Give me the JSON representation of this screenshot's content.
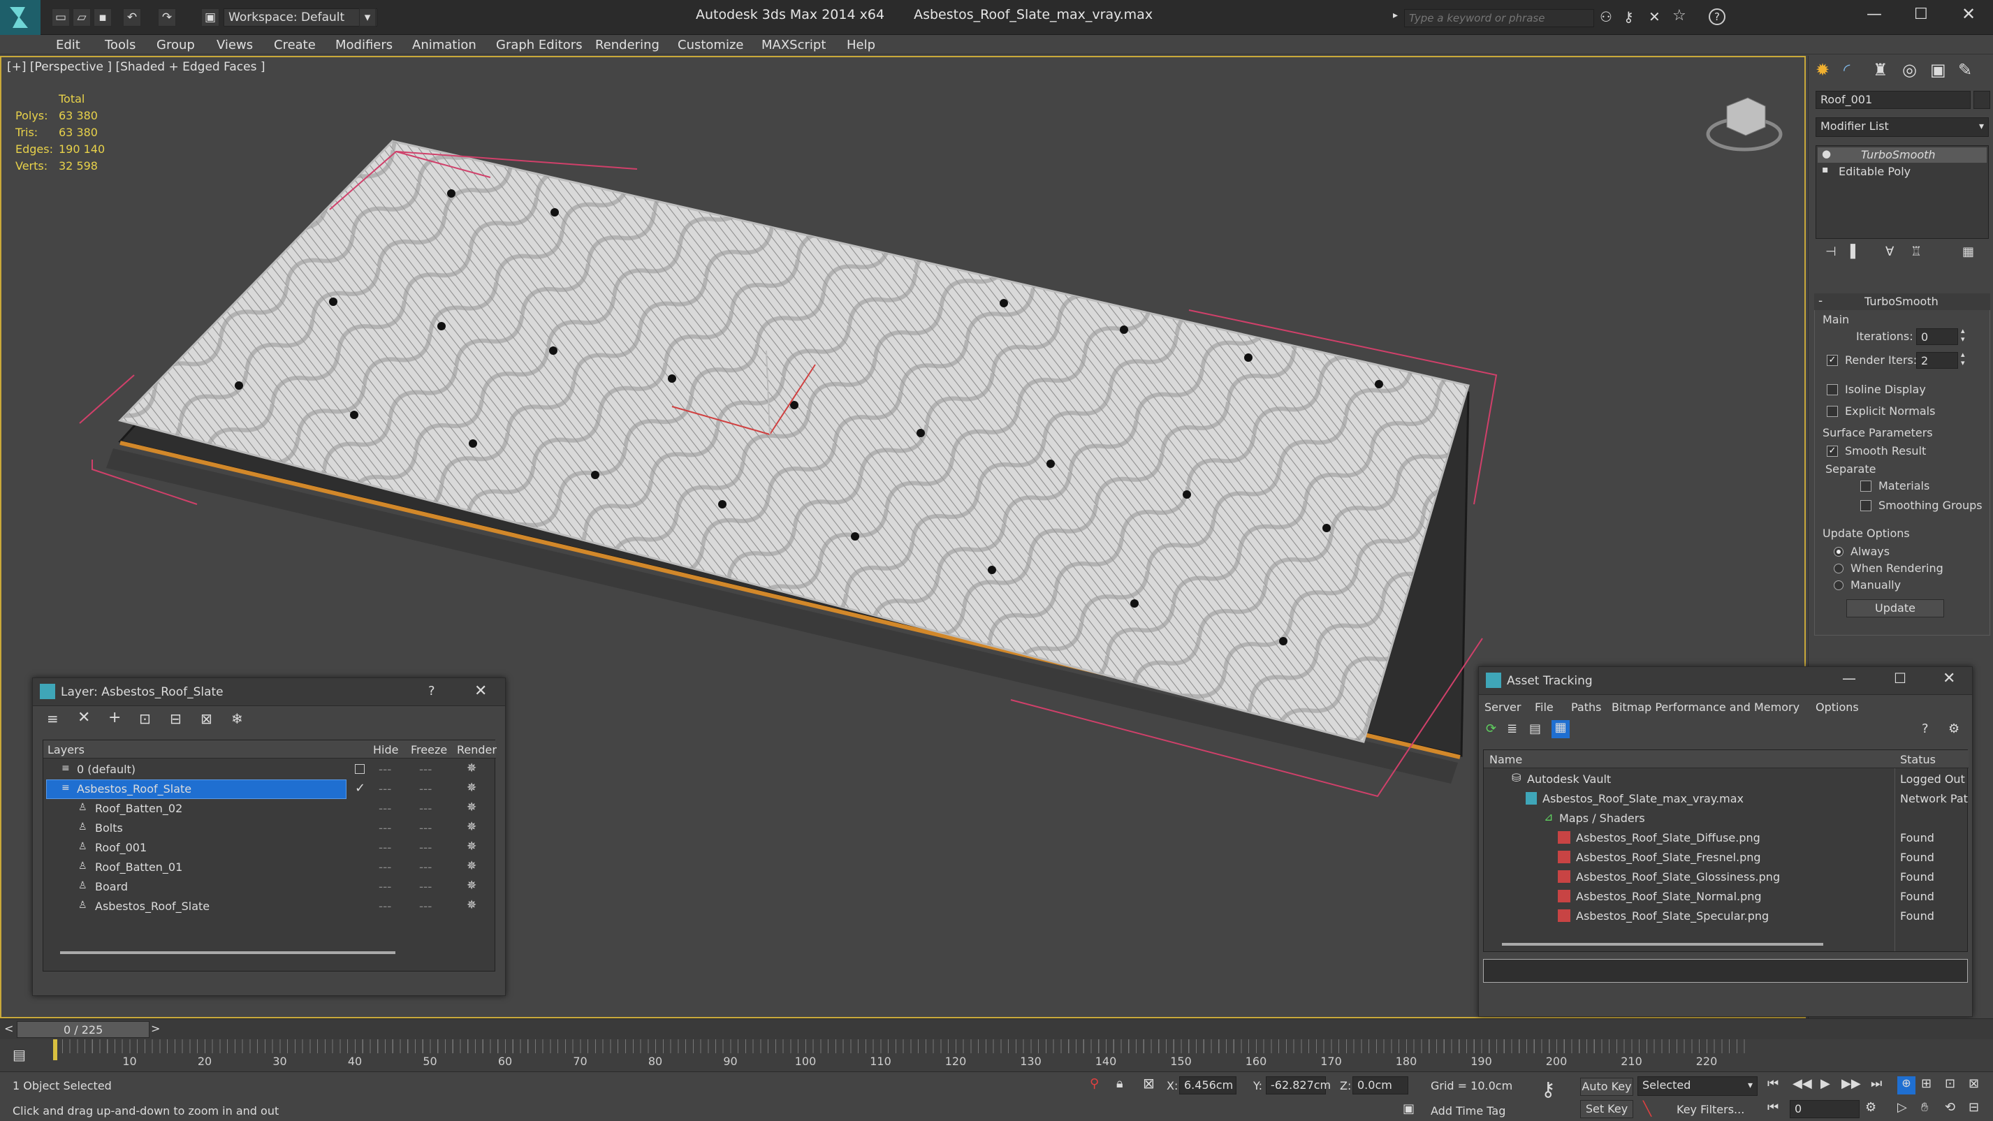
{
  "app": {
    "title": "Autodesk 3ds Max  2014 x64",
    "file": "Asbestos_Roof_Slate_max_vray.max",
    "workspace": "Workspace: Default",
    "search_placeholder": "Type a keyword or phrase"
  },
  "menu": [
    "Edit",
    "Tools",
    "Group",
    "Views",
    "Create",
    "Modifiers",
    "Animation",
    "Graph Editors",
    "Rendering",
    "Customize",
    "MAXScript",
    "Help"
  ],
  "viewport": {
    "label": "[+] [Perspective ] [Shaded + Edged Faces ]",
    "stats_header": "Total",
    "stats": [
      {
        "label": "Polys:",
        "value": "63 380"
      },
      {
        "label": "Tris:",
        "value": "63 380"
      },
      {
        "label": "Edges:",
        "value": "190 140"
      },
      {
        "label": "Verts:",
        "value": "32 598"
      }
    ]
  },
  "command_panel": {
    "object_name": "Roof_001",
    "modifier_list": "Modifier List",
    "stack": [
      "TurboSmooth",
      "Editable Poly"
    ],
    "rollout_title": "TurboSmooth",
    "main_label": "Main",
    "iterations_label": "Iterations:",
    "iterations_value": "0",
    "render_iters_label": "Render Iters:",
    "render_iters_value": "2",
    "isoline": "Isoline Display",
    "explicit_normals": "Explicit Normals",
    "surface_params": "Surface Parameters",
    "smooth_result": "Smooth Result",
    "separate": "Separate",
    "materials": "Materials",
    "smoothing_groups": "Smoothing Groups",
    "update_options": "Update Options",
    "always": "Always",
    "when_rendering": "When Rendering",
    "manually": "Manually",
    "update_button": "Update"
  },
  "layer_dialog": {
    "title": "Layer: Asbestos_Roof_Slate",
    "help": "?",
    "columns": [
      "Layers",
      "Hide",
      "Freeze",
      "Render"
    ],
    "rows": [
      {
        "name": "0 (default)",
        "level": 0
      },
      {
        "name": "Asbestos_Roof_Slate",
        "level": 0,
        "selected": true
      },
      {
        "name": "Roof_Batten_02",
        "level": 1
      },
      {
        "name": "Bolts",
        "level": 1
      },
      {
        "name": "Roof_001",
        "level": 1
      },
      {
        "name": "Roof_Batten_01",
        "level": 1
      },
      {
        "name": "Board",
        "level": 1
      },
      {
        "name": "Asbestos_Roof_Slate",
        "level": 1
      }
    ]
  },
  "asset_dialog": {
    "title": "Asset Tracking",
    "menu": [
      "Server",
      "File",
      "Paths",
      "Bitmap Performance and Memory",
      "Options"
    ],
    "columns": [
      "Name",
      "Status"
    ],
    "rows": [
      {
        "name": "Autodesk Vault",
        "status": "Logged Out",
        "level": 0
      },
      {
        "name": "Asbestos_Roof_Slate_max_vray.max",
        "status": "Network Pat",
        "level": 1
      },
      {
        "name": "Maps / Shaders",
        "status": "",
        "level": 2
      },
      {
        "name": "Asbestos_Roof_Slate_Diffuse.png",
        "status": "Found",
        "level": 3
      },
      {
        "name": "Asbestos_Roof_Slate_Fresnel.png",
        "status": "Found",
        "level": 3
      },
      {
        "name": "Asbestos_Roof_Slate_Glossiness.png",
        "status": "Found",
        "level": 3
      },
      {
        "name": "Asbestos_Roof_Slate_Normal.png",
        "status": "Found",
        "level": 3
      },
      {
        "name": "Asbestos_Roof_Slate_Specular.png",
        "status": "Found",
        "level": 3
      }
    ]
  },
  "timeline": {
    "frame": "0 / 225",
    "ticks": [
      "10",
      "20",
      "30",
      "40",
      "50",
      "60",
      "70",
      "80",
      "90",
      "100",
      "110",
      "120",
      "130",
      "140",
      "150",
      "160",
      "170",
      "180",
      "190",
      "200",
      "210",
      "220"
    ]
  },
  "status": {
    "selected": "1 Object Selected",
    "hint": "Click and drag up-and-down to zoom in and out",
    "x_label": "X:",
    "x_value": "6.456cm",
    "y_label": "Y:",
    "y_value": "-62.827cm",
    "z_label": "Z:",
    "z_value": "0.0cm",
    "grid": "Grid = 10.0cm",
    "add_time_tag": "Add Time Tag",
    "auto_key": "Auto Key",
    "set_key": "Set Key",
    "selected_dropdown": "Selected",
    "key_filters": "Key Filters...",
    "frame_field": "0"
  },
  "colors": {
    "accent_blue": "#1f6fd1",
    "viewport_border": "#c9a93a",
    "stat_yellow": "#e8d24a",
    "selection_pink": "#d0406a"
  }
}
